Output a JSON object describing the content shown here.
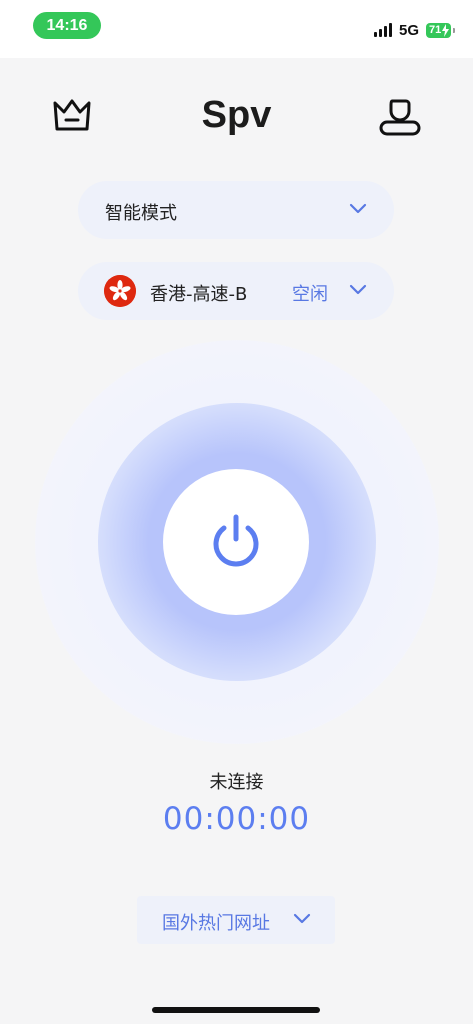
{
  "status_bar": {
    "time": "14:16",
    "network": "5G",
    "battery": "71",
    "time_pill_color": "#34c759"
  },
  "header": {
    "title": "Spv",
    "left_icon": "crown-icon",
    "right_icon": "user-icon"
  },
  "mode_selector": {
    "label": "智能模式",
    "icon": "chevron-down-icon"
  },
  "server_selector": {
    "region": "香港-高速-B",
    "status": "空闲",
    "flag_icon": "hong-kong-flag-icon",
    "status_color": "#5878e3"
  },
  "connection": {
    "power_icon": "power-icon",
    "status": "未连接",
    "timer": "00:00:00",
    "accent_color": "#5c7ef0"
  },
  "popular_sites": {
    "label": "国外热门网址",
    "icon": "chevron-down-icon"
  }
}
